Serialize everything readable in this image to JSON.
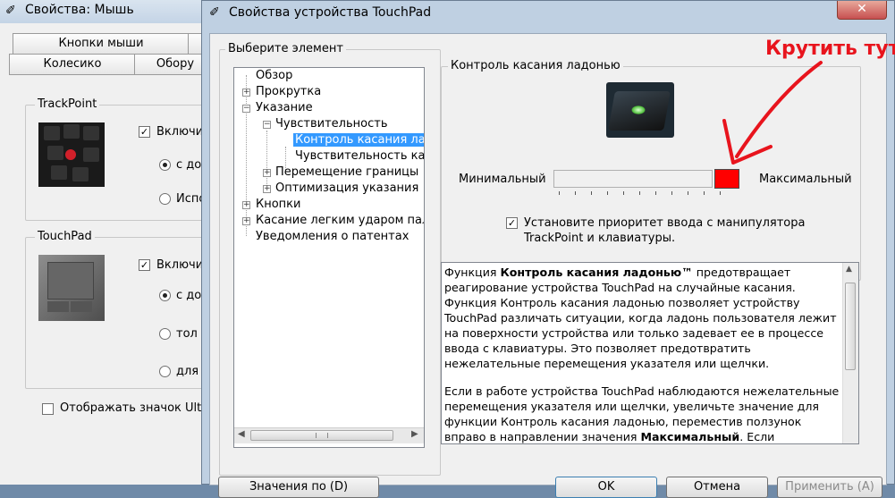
{
  "back_window": {
    "title": "Свойства: Мышь",
    "tabs": [
      "Кнопки мыши",
      "Колесико",
      "Обору"
    ],
    "trackpoint": {
      "group_label": "TrackPoint",
      "enable_label": "Включи",
      "radio1_label": "с до",
      "radio2_label": "Испо"
    },
    "touchpad": {
      "group_label": "TouchPad",
      "enable_label": "Включи",
      "radio1_label": "с до",
      "radio2_label": "тол",
      "radio3_label": "для"
    },
    "show_icon_label": "Отображать значок Ultra"
  },
  "dialog": {
    "title": "Свойства устройства TouchPad",
    "close_glyph": "✕",
    "select_label": "Выберите элемент",
    "tree": [
      {
        "label": "Обзор",
        "expander": ""
      },
      {
        "label": "Прокрутка",
        "expander": "+"
      },
      {
        "label": "Указание",
        "expander": "−"
      },
      {
        "label": "Чувствительность",
        "expander": "−"
      },
      {
        "label": "Контроль касания лад",
        "expander": ""
      },
      {
        "label": "Чувствительность кас",
        "expander": ""
      },
      {
        "label": "Перемещение границы",
        "expander": "+"
      },
      {
        "label": "Оптимизация указания",
        "expander": "+"
      },
      {
        "label": "Кнопки",
        "expander": "+"
      },
      {
        "label": "Касание легким ударом паль",
        "expander": "+"
      },
      {
        "label": "Уведомления о патентах",
        "expander": ""
      }
    ],
    "palm_group_label": "Контроль касания ладонью",
    "slider": {
      "min_label": "Минимальный",
      "max_label": "Максимальный",
      "value": 0.98,
      "thumb_color": "#ff0000"
    },
    "priority_checkbox": {
      "checked": true,
      "line1": "Установите приоритет ввода с манипулятора",
      "line2": "TrackPoint и клавиатуры."
    },
    "description": {
      "p1_pre": "Функция ",
      "p1_bold": "Контроль касания ладонью™",
      "p1_post": " предотвращает реагирование устройства TouchPad на случайные касания. Функция Контроль касания ладонью позволяет устройству TouchPad различать ситуации, когда ладонь пользователя лежит на поверхности устройства или только задевает ее в процессе ввода с клавиатуры. Это позволяет предотвратить нежелательные перемещения указателя или щелчки.",
      "p2_pre": "Если в работе устройства TouchPad наблюдаются нежелательные перемещения указателя или щелчки, увеличьте значение для функции Контроль касания ладонью, переместив ползунок вправо в направлении значения ",
      "p2_bold": "Максимальный",
      "p2_post": ". Если устройство TouchPad не реагирует на необходимые перемещения указателя"
    },
    "buttons": {
      "defaults": "Значения по (D)",
      "ok": "OK",
      "cancel": "Отмена",
      "apply": "Применить (A)"
    }
  },
  "annotation": {
    "text": "Крутить тут",
    "color": "#e8141d"
  }
}
